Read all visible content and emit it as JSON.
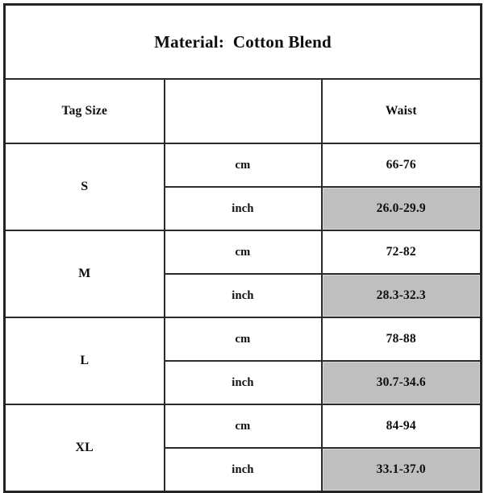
{
  "chart_data": {
    "type": "table",
    "title": "Material:  Cotton Blend",
    "columns": [
      "Tag Size",
      "",
      "Waist"
    ],
    "unit_labels": [
      "cm",
      "inch"
    ],
    "shaded_unit": "inch",
    "shaded_color": "#bfbfbf",
    "border_color": "#242424",
    "rows": [
      {
        "tag_size": "S",
        "measurements": [
          {
            "unit": "cm",
            "waist": "66-76",
            "shaded": false
          },
          {
            "unit": "inch",
            "waist": "26.0-29.9",
            "shaded": true
          }
        ]
      },
      {
        "tag_size": "M",
        "measurements": [
          {
            "unit": "cm",
            "waist": "72-82",
            "shaded": false
          },
          {
            "unit": "inch",
            "waist": "28.3-32.3",
            "shaded": true
          }
        ]
      },
      {
        "tag_size": "L",
        "measurements": [
          {
            "unit": "cm",
            "waist": "78-88",
            "shaded": false
          },
          {
            "unit": "inch",
            "waist": "30.7-34.6",
            "shaded": true
          }
        ]
      },
      {
        "tag_size": "XL",
        "measurements": [
          {
            "unit": "cm",
            "waist": "84-94",
            "shaded": false
          },
          {
            "unit": "inch",
            "waist": "33.1-37.0",
            "shaded": true
          }
        ]
      }
    ]
  }
}
